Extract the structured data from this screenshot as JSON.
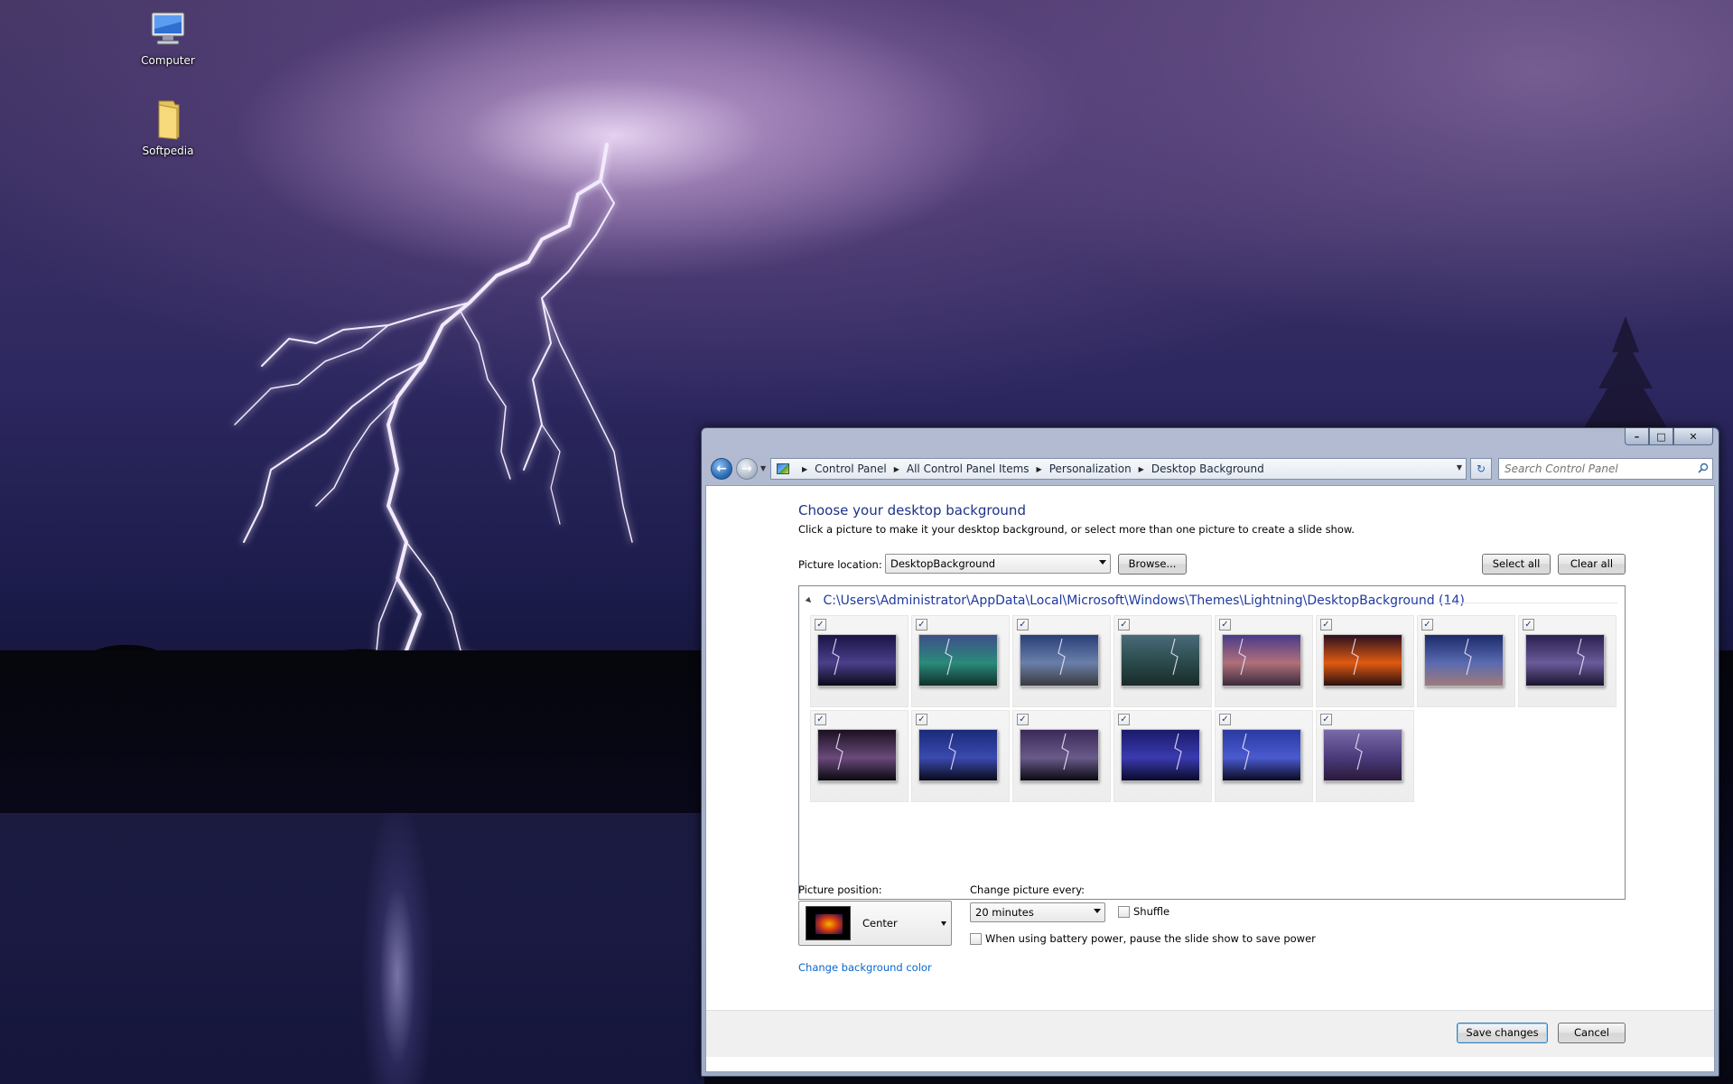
{
  "desktop": {
    "icons": [
      {
        "label": "Computer",
        "icon": "computer-icon"
      },
      {
        "label": "Softpedia",
        "icon": "folder-icon"
      }
    ]
  },
  "window": {
    "controls": {
      "minimize": "–",
      "maximize": "□",
      "close": "✕"
    },
    "nav": {
      "back": "←",
      "forward": "→",
      "refresh": "↻"
    },
    "breadcrumbs": [
      "Control Panel",
      "All Control Panel Items",
      "Personalization",
      "Desktop Background"
    ],
    "search_placeholder": "Search Control Panel"
  },
  "page": {
    "heading": "Choose your desktop background",
    "subtext": "Click a picture to make it your desktop background, or select more than one picture to create a slide show.",
    "picture_location_label": "Picture location:",
    "picture_location_value": "DesktopBackground",
    "browse_label": "Browse...",
    "select_all_label": "Select all",
    "clear_all_label": "Clear all",
    "group_path": "C:\\Users\\Administrator\\AppData\\Local\\Microsoft\\Windows\\Themes\\Lightning\\DesktopBackground (14)",
    "thumbnails": [
      {
        "checked": true,
        "colors": [
          "#1a1446",
          "#4a3f8a",
          "#0a0a1a"
        ]
      },
      {
        "checked": true,
        "colors": [
          "#3e4f8a",
          "#2a8a7a",
          "#10302a"
        ]
      },
      {
        "checked": true,
        "colors": [
          "#2a3f7a",
          "#6a7fa8",
          "#3a3a40"
        ]
      },
      {
        "checked": true,
        "colors": [
          "#4a6a7a",
          "#2a4a4a",
          "#1a2a2a"
        ]
      },
      {
        "checked": true,
        "colors": [
          "#4a3a8a",
          "#b0707a",
          "#3a2a3a"
        ]
      },
      {
        "checked": true,
        "colors": [
          "#2a1020",
          "#e05a10",
          "#2a1010"
        ]
      },
      {
        "checked": true,
        "colors": [
          "#1a2a6a",
          "#5a6ab0",
          "#a07a7a"
        ]
      },
      {
        "checked": true,
        "colors": [
          "#2a2050",
          "#6a5a9a",
          "#1a1530"
        ]
      },
      {
        "checked": true,
        "colors": [
          "#1a1020",
          "#6a4a7a",
          "#0a0810"
        ]
      },
      {
        "checked": true,
        "colors": [
          "#1a2a7a",
          "#3a4ab0",
          "#0a0a1a"
        ]
      },
      {
        "checked": true,
        "colors": [
          "#3a2a5a",
          "#6a5a8a",
          "#0a0a10"
        ]
      },
      {
        "checked": true,
        "colors": [
          "#1a1a6a",
          "#3a3ab0",
          "#0a0a2a"
        ]
      },
      {
        "checked": true,
        "colors": [
          "#2a3aa0",
          "#4a5ad0",
          "#0a0a20"
        ]
      },
      {
        "checked": true,
        "colors": [
          "#7a6aa8",
          "#4a3a7a",
          "#2a1a3a"
        ]
      }
    ],
    "picture_position_label": "Picture position:",
    "picture_position_value": "Center",
    "change_every_label": "Change picture every:",
    "change_every_value": "20 minutes",
    "shuffle_label": "Shuffle",
    "battery_label": "When using battery power, pause the slide show to save power",
    "change_color_link": "Change background color",
    "save_label": "Save changes",
    "cancel_label": "Cancel"
  },
  "colors": {
    "heading": "#1e3287",
    "link": "#0a66cc",
    "group_header": "#1e3a9e"
  }
}
